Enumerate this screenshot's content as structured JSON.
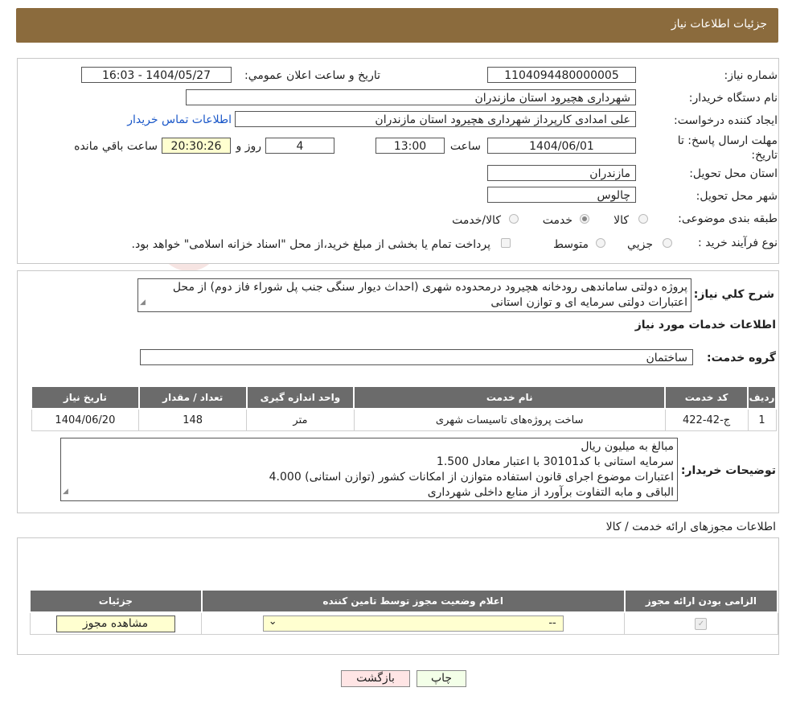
{
  "header": {
    "title": "جزئیات اطلاعات نیاز"
  },
  "form": {
    "need_number_label": "شماره نیاز:",
    "need_number": "1104094480000005",
    "announce_label": "تاریخ و ساعت اعلان عمومي:",
    "announce_value": "1404/05/27 - 16:03",
    "buyer_org_label": "نام دستگاه خریدار:",
    "buyer_org": "شهرداری هچیرود استان مازندران",
    "requester_label": "ایجاد کننده درخواست:",
    "requester": "علی امدادی کارپرداز شهرداری هچیرود استان مازندران",
    "contact_link": "اطلاعات تماس خریدار",
    "deadline_label": "مهلت ارسال پاسخ: تا تاریخ:",
    "deadline_date": "1404/06/01",
    "time_label": "ساعت",
    "deadline_time": "13:00",
    "days_value": "4",
    "days_label": "روز و",
    "remaining_time": "20:30:26",
    "remaining_label": "ساعت باقي مانده",
    "province_label": "استان محل تحویل:",
    "province": "مازندران",
    "city_label": "شهر محل تحویل:",
    "city": "چالوس",
    "category_label": "طبقه بندی موضوعی:",
    "category_options": [
      "کالا",
      "خدمت",
      "کالا/خدمت"
    ],
    "category_selected": "خدمت",
    "process_label": "نوع فرآیند خرید :",
    "process_options": [
      "جزیي",
      "متوسط"
    ],
    "process_note": "پرداخت تمام یا بخشی از مبلغ خرید،از محل \"اسناد خزانه اسلامی\" خواهد بود."
  },
  "description": {
    "label": "شرح کلي نیاز:",
    "text": "پروژه دولتی ساماندهی رودخانه هچیرود درمحدوده شهری (احداث دیوار سنگی جنب پل شوراء فاز دوم) از محل اعتبارات دولتی سرمایه ای و توازن استانی"
  },
  "services": {
    "section_title": "اطلاعات خدمات مورد نیاز",
    "group_label": "گروه خدمت:",
    "group_value": "ساختمان",
    "columns": [
      "ردیف",
      "کد خدمت",
      "نام خدمت",
      "واحد اندازه گیری",
      "تعداد / مقدار",
      "تاریخ نیاز"
    ],
    "rows": [
      [
        "1",
        "ج-42-422",
        "ساخت پروژه‌های تاسیسات شهری",
        "متر",
        "148",
        "1404/06/20"
      ]
    ]
  },
  "buyer_notes": {
    "label": "توضیحات خریدار:",
    "lines": [
      "مبالغ به میلیون ریال",
      "سرمایه استانی با کد30101 با اعتبار معادل 1.500",
      "اعتبارات موضوع اجرای قانون استفاده متوازن از امکانات کشور (توازن استانی) 4.000",
      "الباقی و مابه التفاوت برآورد از منابع داخلی شهرداری"
    ]
  },
  "permits": {
    "section_title": "اطلاعات مجوزهای ارائه خدمت / کالا",
    "columns": [
      "الزامی بودن ارائه مجوز",
      "اعلام وضعیت مجوز توسط تامین کننده",
      "جزئیات"
    ],
    "select_value": "--",
    "view_button": "مشاهده مجوز"
  },
  "actions": {
    "print": "چاپ",
    "back": "بازگشت"
  },
  "colors": {
    "header_bg": "#8b6b3d",
    "table_header_bg": "#6b6b6b",
    "link": "#1a57c8"
  }
}
